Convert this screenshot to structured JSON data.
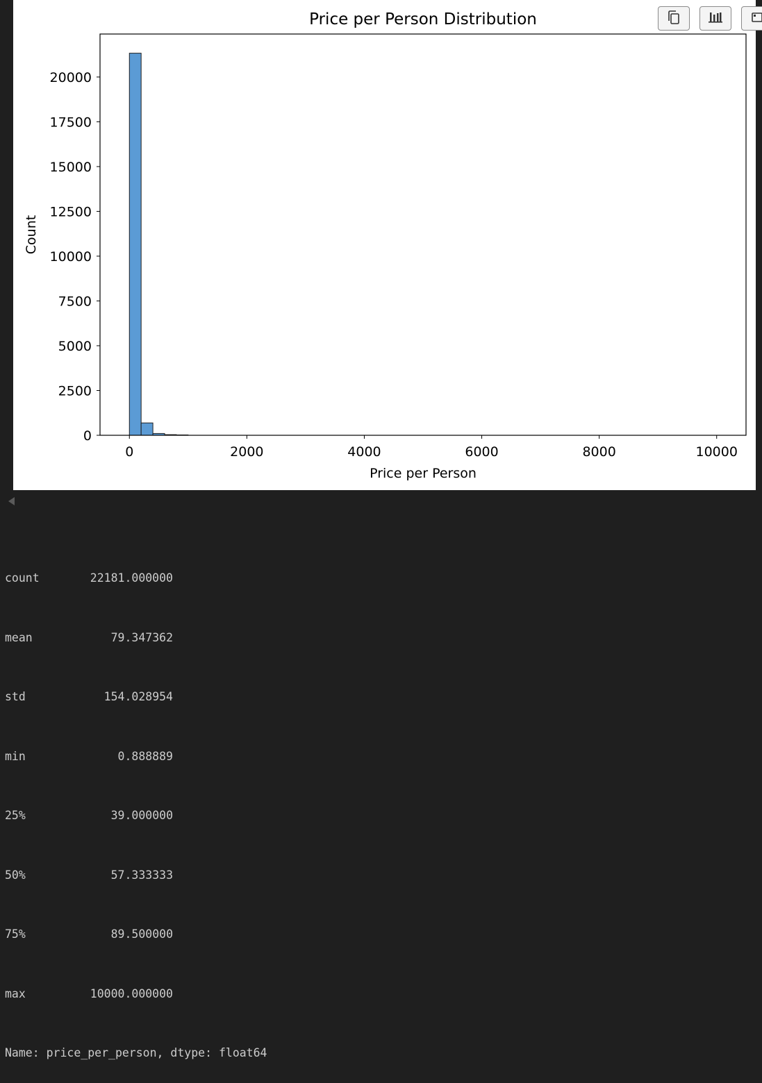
{
  "toolbar": {
    "copy_icon": "copy-icon",
    "chart_icon": "bar-chart-icon",
    "expand_icon": "expand-icon"
  },
  "chart_data": {
    "type": "bar",
    "title": "Price per Person Distribution",
    "xlabel": "Price per Person",
    "ylabel": "Count",
    "xlim": [
      -500,
      10500
    ],
    "ylim": [
      0,
      22400
    ],
    "xticks": [
      0,
      2000,
      4000,
      6000,
      8000,
      10000
    ],
    "yticks": [
      0,
      2500,
      5000,
      7500,
      10000,
      12500,
      15000,
      17500,
      20000
    ],
    "bin_width": 200,
    "bins": [
      {
        "x0": 0,
        "x1": 200,
        "count": 21330
      },
      {
        "x0": 200,
        "x1": 400,
        "count": 690
      },
      {
        "x0": 400,
        "x1": 600,
        "count": 100
      },
      {
        "x0": 600,
        "x1": 800,
        "count": 35
      },
      {
        "x0": 800,
        "x1": 1000,
        "count": 20
      }
    ],
    "bar_color": "#5b9bd5",
    "edge_color": "#1f1f1f",
    "grid": false,
    "legend": "none"
  },
  "output": {
    "rows": [
      {
        "key": "count",
        "value": "22181.000000"
      },
      {
        "key": "mean",
        "value": "79.347362"
      },
      {
        "key": "std",
        "value": "154.028954"
      },
      {
        "key": "min",
        "value": "0.888889"
      },
      {
        "key": "25%",
        "value": "39.000000"
      },
      {
        "key": "50%",
        "value": "57.333333"
      },
      {
        "key": "75%",
        "value": "89.500000"
      },
      {
        "key": "max",
        "value": "10000.000000"
      }
    ],
    "footer": "Name: price_per_person, dtype: float64"
  }
}
